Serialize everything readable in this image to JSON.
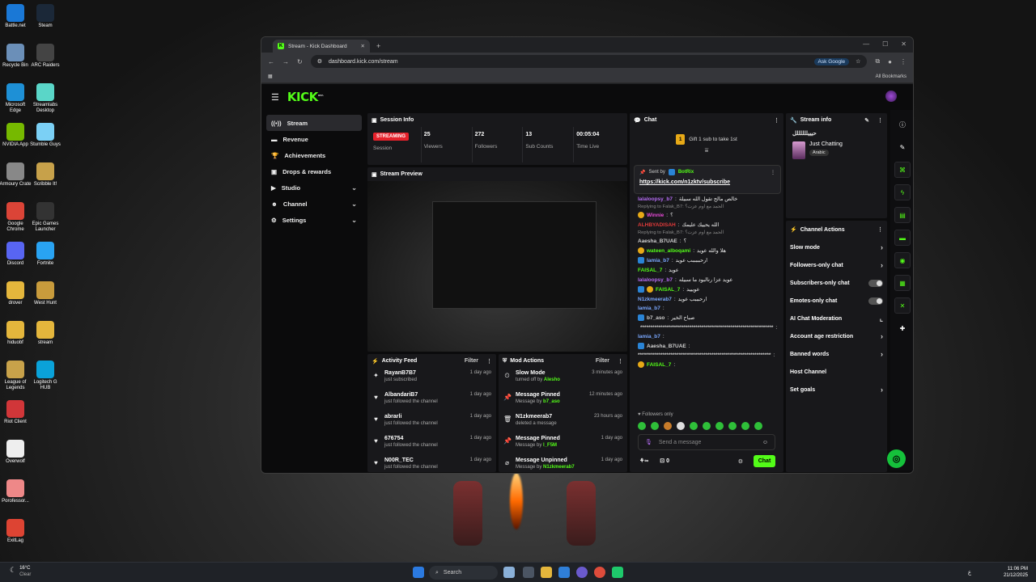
{
  "desktop": {
    "icons_left": [
      "Battle.net",
      "Recycle Bin",
      "Microsoft Edge",
      "NVIDIA App",
      "Armoury Crate",
      "Google Chrome",
      "Discord",
      "drover",
      "hiduobf",
      "League of Legends",
      "Riot Client",
      "Overwolf",
      "Porofessor...",
      "ExitLag"
    ],
    "icons_right": [
      "Steam",
      "ARC Raiders",
      "Streamlabs Desktop",
      "Stumble Guys",
      "Scribble It!",
      "Epic Games Launcher",
      "Fortnite",
      "West Hunt",
      "stream",
      "Logitech G HUB"
    ]
  },
  "browser": {
    "tab_title": "Stream - Kick Dashboard",
    "url": "dashboard.kick.com/stream",
    "ask_google": "Ask Google",
    "all_bookmarks": "All Bookmarks"
  },
  "app": {
    "logo": "KICK",
    "logo_tag": "BETA",
    "sidebar": [
      {
        "label": "Stream",
        "icon": "broadcast-icon"
      },
      {
        "label": "Revenue",
        "icon": "money-icon"
      },
      {
        "label": "Achievements",
        "icon": "trophy-icon"
      },
      {
        "label": "Drops & rewards",
        "icon": "gift-icon"
      },
      {
        "label": "Studio",
        "icon": "video-icon"
      },
      {
        "label": "Channel",
        "icon": "user-icon"
      },
      {
        "label": "Settings",
        "icon": "gear-icon"
      }
    ],
    "session": {
      "title": "Session Info",
      "badge": "STREAMING",
      "session_label": "Session",
      "stats": [
        {
          "value": "25",
          "label": "Viewers"
        },
        {
          "value": "272",
          "label": "Followers"
        },
        {
          "value": "13",
          "label": "Sub Counts"
        },
        {
          "value": "00:05:04",
          "label": "Time Live"
        }
      ]
    },
    "preview": {
      "title": "Stream Preview"
    },
    "activity": {
      "title": "Activity Feed",
      "filter": "Filter",
      "items": [
        {
          "icon": "star-icon",
          "name": "RayanB7B7",
          "sub": "just subscribed",
          "time": "1 day ago"
        },
        {
          "icon": "heart-icon",
          "name": "AlbandariB7",
          "sub": "just followed the channel",
          "time": "1 day ago"
        },
        {
          "icon": "heart-icon",
          "name": "abrarli",
          "sub": "just followed the channel",
          "time": "1 day ago"
        },
        {
          "icon": "heart-icon",
          "name": "676754",
          "sub": "just followed the channel",
          "time": "1 day ago"
        },
        {
          "icon": "heart-icon",
          "name": "N00R_TEC",
          "sub": "just followed the channel",
          "time": "1 day ago"
        }
      ]
    },
    "modactions": {
      "title": "Mod Actions",
      "filter": "Filter",
      "items": [
        {
          "icon": "clock-icon",
          "name": "Slow Mode",
          "sub": "turned off by",
          "who": "Alesho",
          "time": "3 minutes ago"
        },
        {
          "icon": "pin-icon",
          "name": "Message Pinned",
          "sub": "Message by",
          "who": "b7_aso",
          "time": "12 minutes ago"
        },
        {
          "icon": "trash-icon",
          "name": "N1zkmeerab7",
          "sub": "deleted a message",
          "who": "",
          "time": "23 hours ago"
        },
        {
          "icon": "pin-icon",
          "name": "Message Pinned",
          "sub": "Message by",
          "who": "l_F5M",
          "time": "1 day ago"
        },
        {
          "icon": "unpin-icon",
          "name": "Message Unpinned",
          "sub": "Message by",
          "who": "N1zkmeerab7",
          "time": "1 day ago"
        }
      ]
    },
    "chat": {
      "title": "Chat",
      "gift_count": "1",
      "gift_text": "Gift 1 sub to take 1st",
      "pinned_sent_by": "Sent by",
      "pinned_user": "BotRix",
      "pinned_link": "https://kick.com/n1zktv/subscribe",
      "lines": [
        {
          "type": "msg",
          "user": "lalaloopsy_b7",
          "color": "#b46cf2",
          "text": "خالص مالح تقول الله سبيلة"
        },
        {
          "type": "reply",
          "text": "Replying to Falak_B7: الحمد مع اوم عزت؟"
        },
        {
          "type": "msg",
          "user": "Winnie",
          "color": "#e84ad8",
          "text": "؟"
        },
        {
          "type": "msg",
          "user": "ALHBYADISAH",
          "color": "#e13a3a",
          "text": "الله يحييك عليمك"
        },
        {
          "type": "reply",
          "text": "Replying to Falak_B7: الحمد مع اوم عزت؟"
        },
        {
          "type": "msg",
          "user": "Aaesha_B7UAE",
          "color": "#cfcfcf",
          "text": "؟"
        },
        {
          "type": "msg",
          "user": "wateen_alboqami",
          "color": "#53fc18",
          "text": "هلا والله عويد"
        },
        {
          "type": "msg",
          "user": "lamia_b7",
          "color": "#7aa8ff",
          "text": "ارحبببببب عويد"
        },
        {
          "type": "msg",
          "user": "FAISAL_7",
          "color": "#53fc18",
          "text": "عويد"
        },
        {
          "type": "msg",
          "user": "lalaloopsy_b7",
          "color": "#b46cf2",
          "text": "عويد عزا رنالبود ما سبيله"
        },
        {
          "type": "msg",
          "user": "FAISAL_7",
          "color": "#53fc18",
          "text": "عويييد"
        },
        {
          "type": "msg",
          "user": "N1zkmeerab7",
          "color": "#7aa8ff",
          "text": "ارحبببب عويد"
        },
        {
          "type": "msg",
          "user": "lamia_b7",
          "color": "#7aa8ff",
          "text": ""
        },
        {
          "type": "msg",
          "user": "b7_aso",
          "color": "#cfcfcf",
          "text": "صباح الخير"
        },
        {
          "type": "msg",
          "user": "*****************************************************************",
          "color": "#cfcfcf",
          "text": ""
        },
        {
          "type": "msg",
          "user": "lamia_b7",
          "color": "#7aa8ff",
          "text": ""
        },
        {
          "type": "msg",
          "user": "Aaesha_B7UAE",
          "color": "#cfcfcf",
          "text": ""
        },
        {
          "type": "msg",
          "user": "*****************************************************************",
          "color": "#cfcfcf",
          "text": ""
        },
        {
          "type": "msg",
          "user": "FAISAL_7",
          "color": "#53fc18",
          "text": ""
        }
      ],
      "followers_only": "Followers only",
      "placeholder": "Send a message",
      "count_a": "0",
      "button": "Chat"
    },
    "streaminfo": {
      "title": "Stream info",
      "stream_title": "حيييللللللل",
      "category": "Just Chatting",
      "tag": "Arabic"
    },
    "channelactions": {
      "title": "Channel Actions",
      "items": [
        {
          "label": "Slow mode",
          "ctl": "chevron"
        },
        {
          "label": "Followers-only chat",
          "ctl": "chevron"
        },
        {
          "label": "Subscribers-only chat",
          "ctl": "toggle"
        },
        {
          "label": "Emotes-only chat",
          "ctl": "toggle"
        },
        {
          "label": "AI Chat Moderation",
          "ctl": "chart"
        },
        {
          "label": "Account age restriction",
          "ctl": "chevron"
        },
        {
          "label": "Banned words",
          "ctl": "chevron"
        },
        {
          "label": "Host Channel",
          "ctl": "none"
        },
        {
          "label": "Set goals",
          "ctl": "chevron"
        }
      ]
    }
  },
  "taskbar": {
    "temp": "16°C",
    "weather": "Clear",
    "search": "Search",
    "time": "11:06 PM",
    "date": "21/12/2025",
    "lang": "ع"
  }
}
